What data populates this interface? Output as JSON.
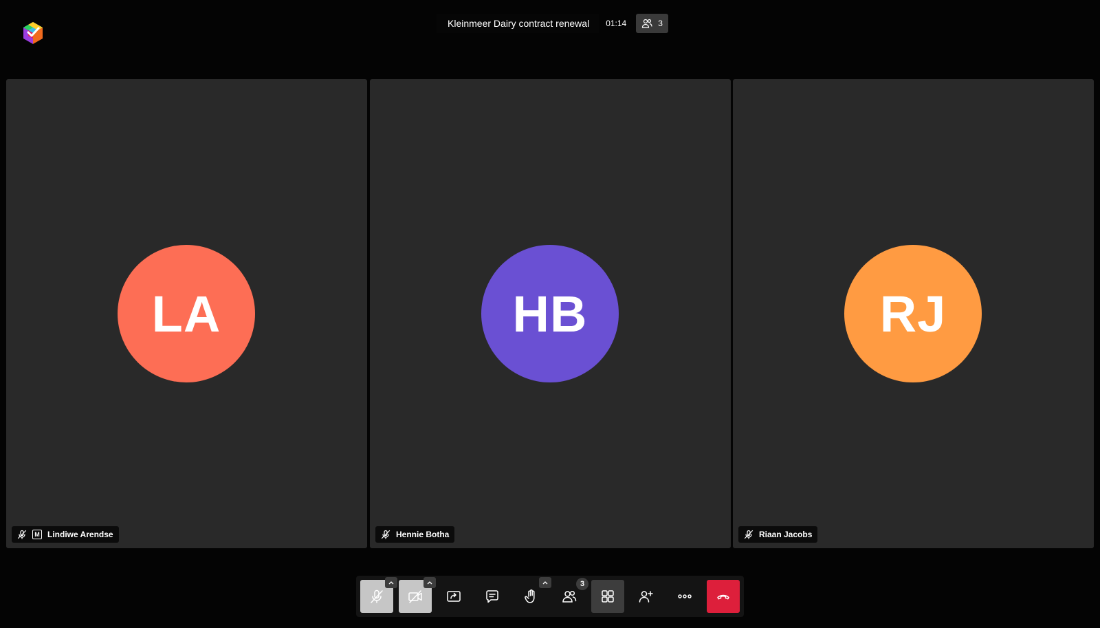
{
  "meeting": {
    "title": "Kleinmeer Dairy contract renewal",
    "timer": "01:14",
    "participant_count": "3"
  },
  "participants": [
    {
      "initials": "LA",
      "name": "Lindiwe Arendse",
      "avatar_color": "#fd6e55",
      "muted": true,
      "moderator": true,
      "moderator_label": "M"
    },
    {
      "initials": "HB",
      "name": "Hennie Botha",
      "avatar_color": "#6a50d3",
      "muted": true,
      "moderator": false
    },
    {
      "initials": "RJ",
      "name": "Riaan Jacobs",
      "avatar_color": "#ff9b42",
      "muted": true,
      "moderator": false
    }
  ],
  "toolbar": {
    "buttons": [
      {
        "id": "microphone",
        "icon": "microphone-off-icon",
        "state": "disabled",
        "has_options": true
      },
      {
        "id": "camera",
        "icon": "camera-off-icon",
        "state": "disabled",
        "has_options": true
      },
      {
        "id": "share-screen",
        "icon": "share-screen-icon",
        "state": "normal"
      },
      {
        "id": "chat",
        "icon": "chat-icon",
        "state": "normal"
      },
      {
        "id": "raise-hand",
        "icon": "raise-hand-icon",
        "state": "normal",
        "has_options": true
      },
      {
        "id": "participants",
        "icon": "participants-icon",
        "state": "normal",
        "badge": "3"
      },
      {
        "id": "tile-view",
        "icon": "tile-view-icon",
        "state": "active"
      },
      {
        "id": "invite",
        "icon": "invite-person-icon",
        "state": "normal"
      },
      {
        "id": "more",
        "icon": "more-options-icon",
        "state": "normal"
      },
      {
        "id": "leave",
        "icon": "hang-up-icon",
        "state": "hangup"
      }
    ]
  },
  "colors": {
    "background": "#040404",
    "tile": "#292929",
    "hangup": "#dd1f3b",
    "disabled_button": "#c6c6c6"
  }
}
